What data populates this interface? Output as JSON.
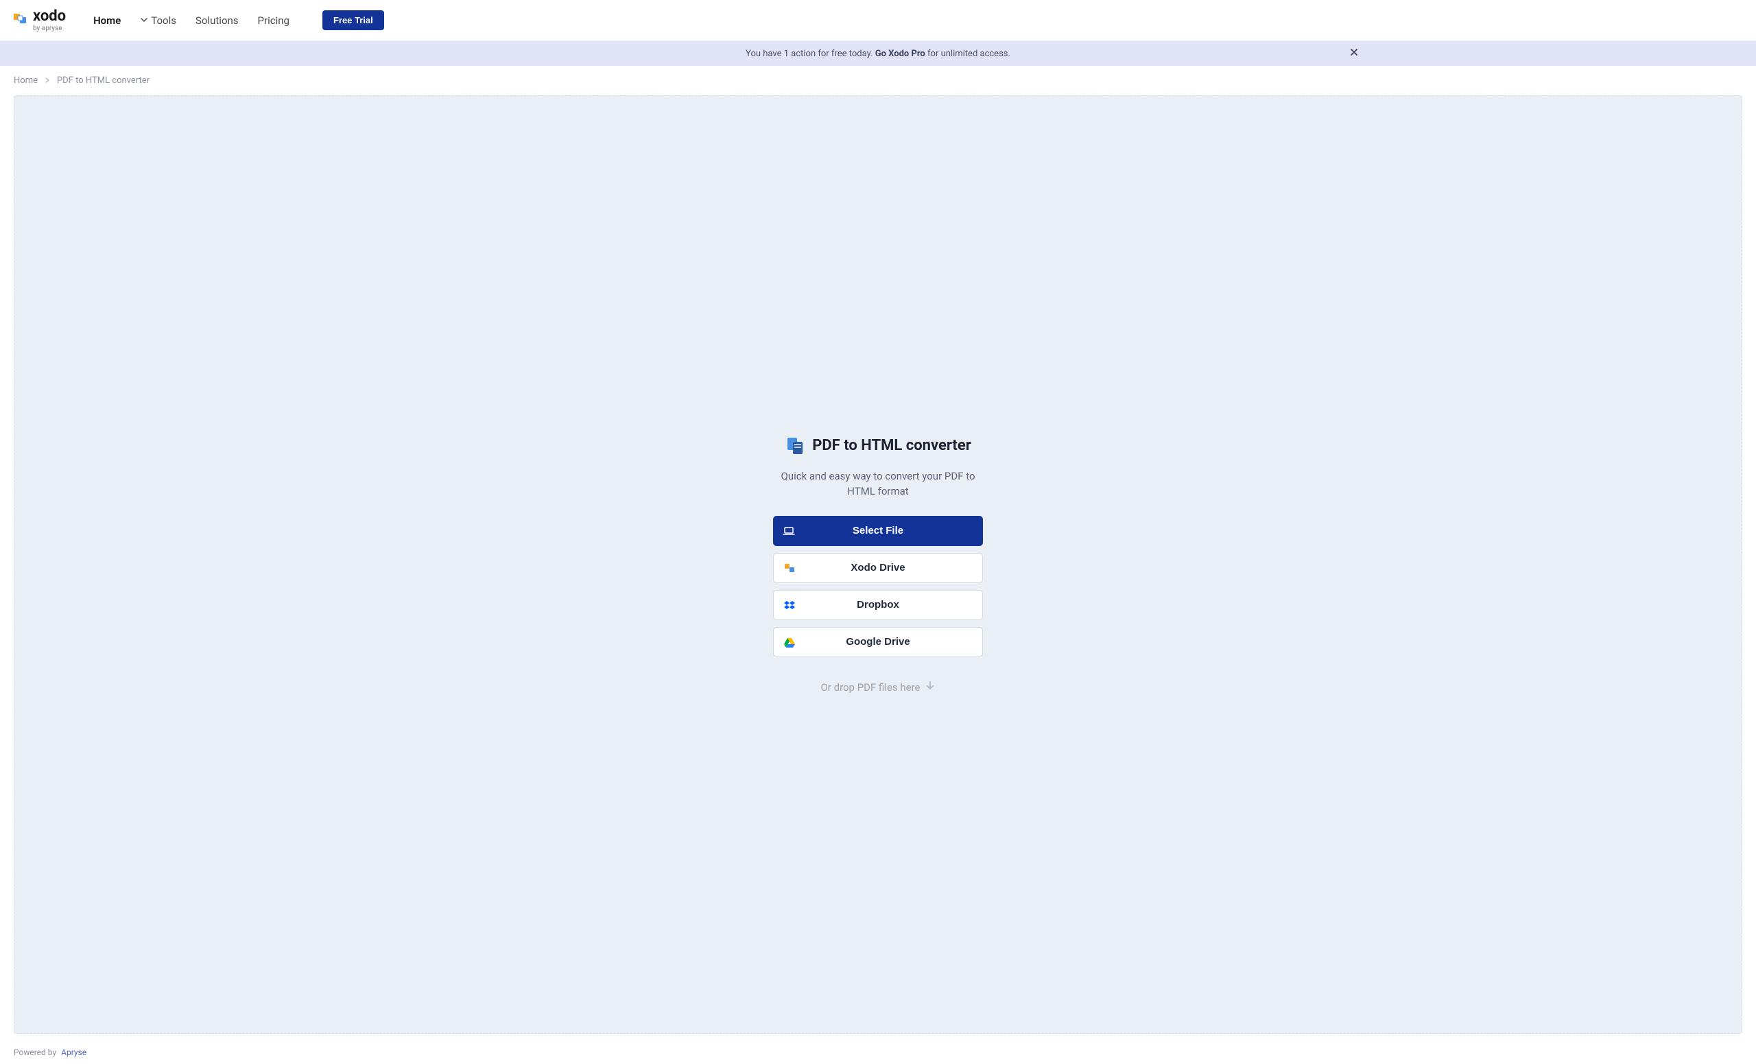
{
  "brand": {
    "name": "xodo",
    "subline": "by apryse"
  },
  "nav": {
    "home": "Home",
    "tools": "Tools",
    "solutions": "Solutions",
    "pricing": "Pricing",
    "free_trial": "Free Trial"
  },
  "banner": {
    "prefix": "You have 1 action for free today. ",
    "cta": "Go Xodo Pro",
    "suffix": " for unlimited access."
  },
  "breadcrumb": {
    "home": "Home",
    "current": "PDF to HTML converter"
  },
  "tool": {
    "title": "PDF to HTML converter",
    "description": "Quick and easy way to convert your PDF to HTML format",
    "buttons": {
      "select_file": "Select File",
      "xodo_drive": "Xodo Drive",
      "dropbox": "Dropbox",
      "google_drive": "Google Drive"
    },
    "drop_hint": "Or drop PDF files here"
  },
  "footer": {
    "powered_by": "Powered by",
    "company": "Apryse"
  }
}
